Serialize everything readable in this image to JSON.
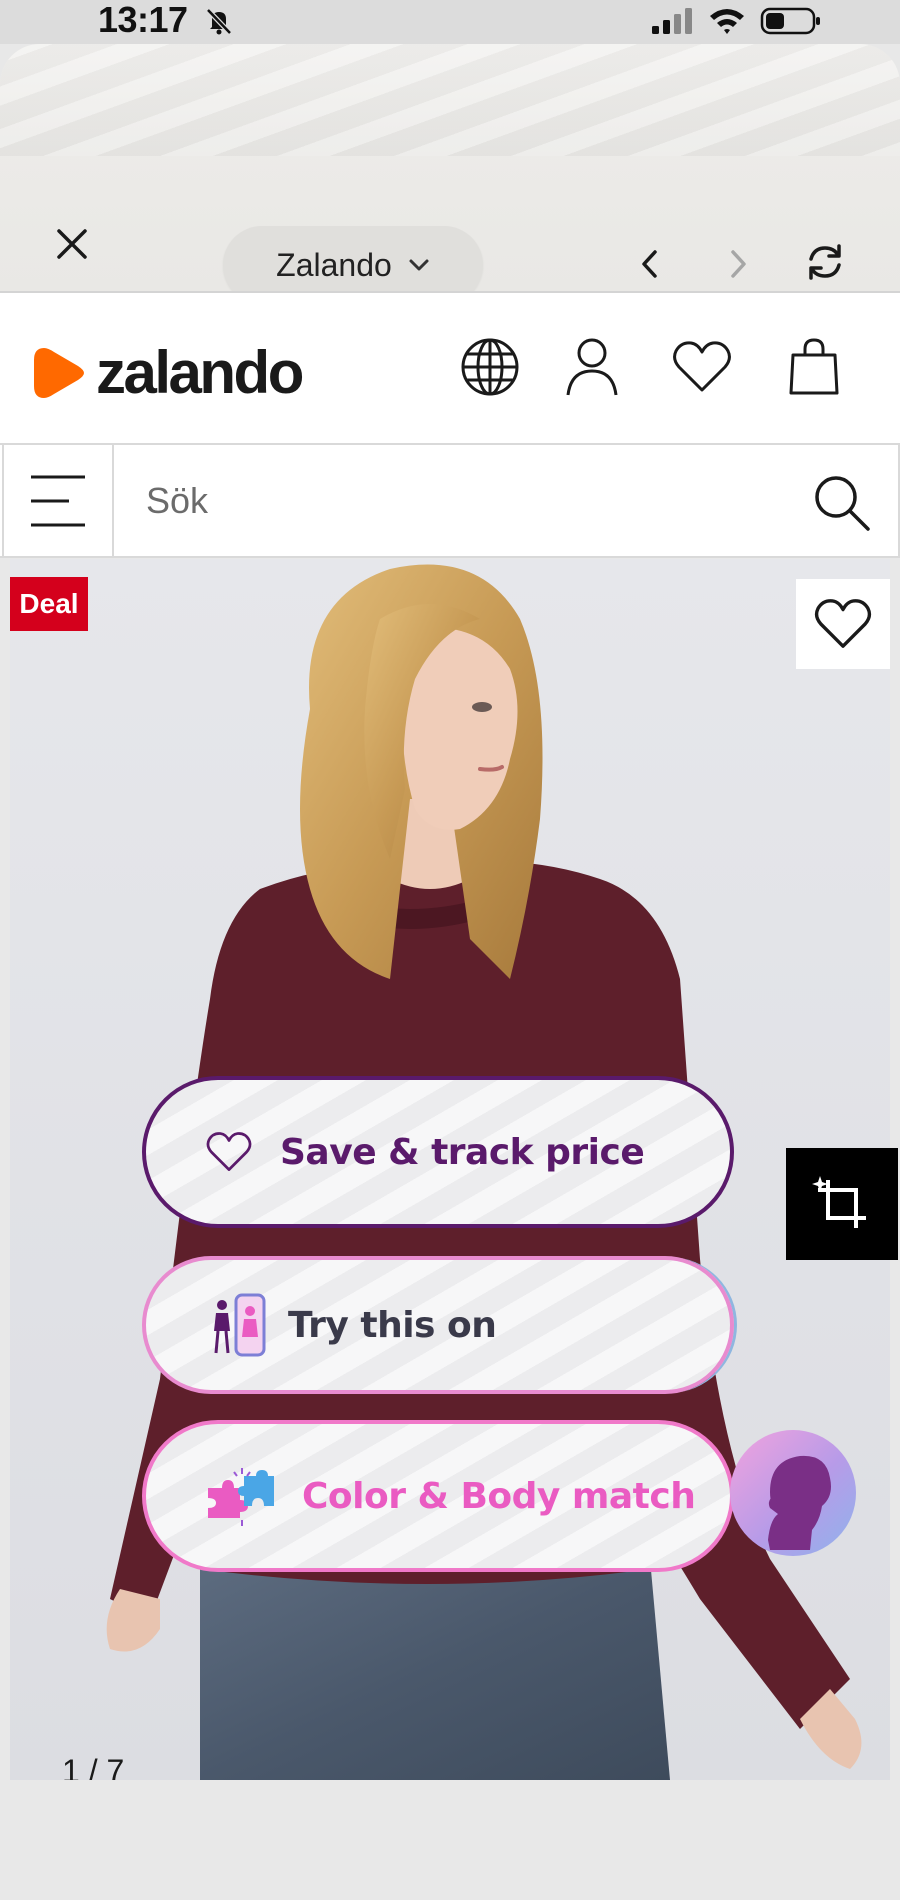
{
  "status_bar": {
    "time": "13:17",
    "icons": [
      "bell-slash-icon",
      "signal-icon",
      "wifi-icon",
      "battery-icon"
    ]
  },
  "browser": {
    "site_label": "Zalando",
    "close_icon": "close-icon",
    "back_icon": "chevron-left-icon",
    "forward_icon": "chevron-right-icon",
    "reload_icon": "reload-icon"
  },
  "header": {
    "logo_text": "zalando",
    "brand_color": "#ff6900",
    "icons": [
      "globe-icon",
      "user-icon",
      "heart-icon",
      "bag-icon"
    ]
  },
  "search": {
    "placeholder": "Sök",
    "value": ""
  },
  "product": {
    "badge": "Deal",
    "badge_color": "#d4001c",
    "pager": "1 / 7"
  },
  "overlay_buttons": {
    "save": "Save & track price",
    "try_on": "Try this on",
    "color_match": "Color & Body match"
  }
}
